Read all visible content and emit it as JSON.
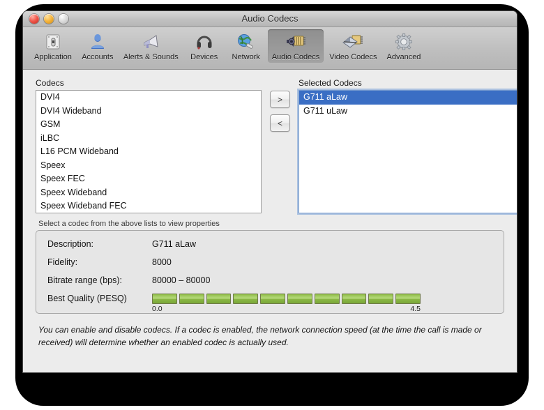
{
  "window": {
    "title": "Audio Codecs",
    "traffic_lights": [
      "close-button",
      "minimize-button",
      "zoom-button"
    ]
  },
  "toolbar": {
    "items": [
      {
        "label": "Application",
        "icon": "application-icon",
        "selected": false
      },
      {
        "label": "Accounts",
        "icon": "accounts-icon",
        "selected": false
      },
      {
        "label": "Alerts & Sounds",
        "icon": "alerts-sounds-icon",
        "selected": false
      },
      {
        "label": "Devices",
        "icon": "devices-icon",
        "selected": false
      },
      {
        "label": "Network",
        "icon": "network-icon",
        "selected": false
      },
      {
        "label": "Audio Codecs",
        "icon": "audio-codecs-icon",
        "selected": true
      },
      {
        "label": "Video Codecs",
        "icon": "video-codecs-icon",
        "selected": false
      },
      {
        "label": "Advanced",
        "icon": "advanced-icon",
        "selected": false
      }
    ]
  },
  "codecs_panel": {
    "label": "Codecs",
    "items": [
      "DVI4",
      "DVI4 Wideband",
      "GSM",
      "iLBC",
      "L16 PCM Wideband",
      "Speex",
      "Speex FEC",
      "Speex Wideband",
      "Speex Wideband FEC"
    ]
  },
  "transfer": {
    "add_label": ">",
    "remove_label": "<"
  },
  "selected_panel": {
    "label": "Selected Codecs",
    "items": [
      {
        "name": "G711 aLaw",
        "selected": true
      },
      {
        "name": "G711 uLaw",
        "selected": false
      }
    ],
    "selection_color": "#3a6ec4"
  },
  "properties": {
    "hint": "Select a codec from the above lists to view properties",
    "rows": [
      {
        "label": "Description:",
        "value": "G711 aLaw"
      },
      {
        "label": "Fidelity:",
        "value": "8000"
      },
      {
        "label": "Bitrate range (bps):",
        "value": "80000 – 80000"
      }
    ],
    "quality": {
      "label": "Best Quality (PESQ)",
      "segments_total": 10,
      "segments_filled": 10,
      "min_label": "0.0",
      "max_label": "4.5",
      "fill_color": "#8fbb46"
    }
  },
  "footer": {
    "text": "You can enable and disable codecs. If a codec is enabled, the network connection speed (at the time the call is made or received) will determine whether an enabled codec is actually used."
  }
}
